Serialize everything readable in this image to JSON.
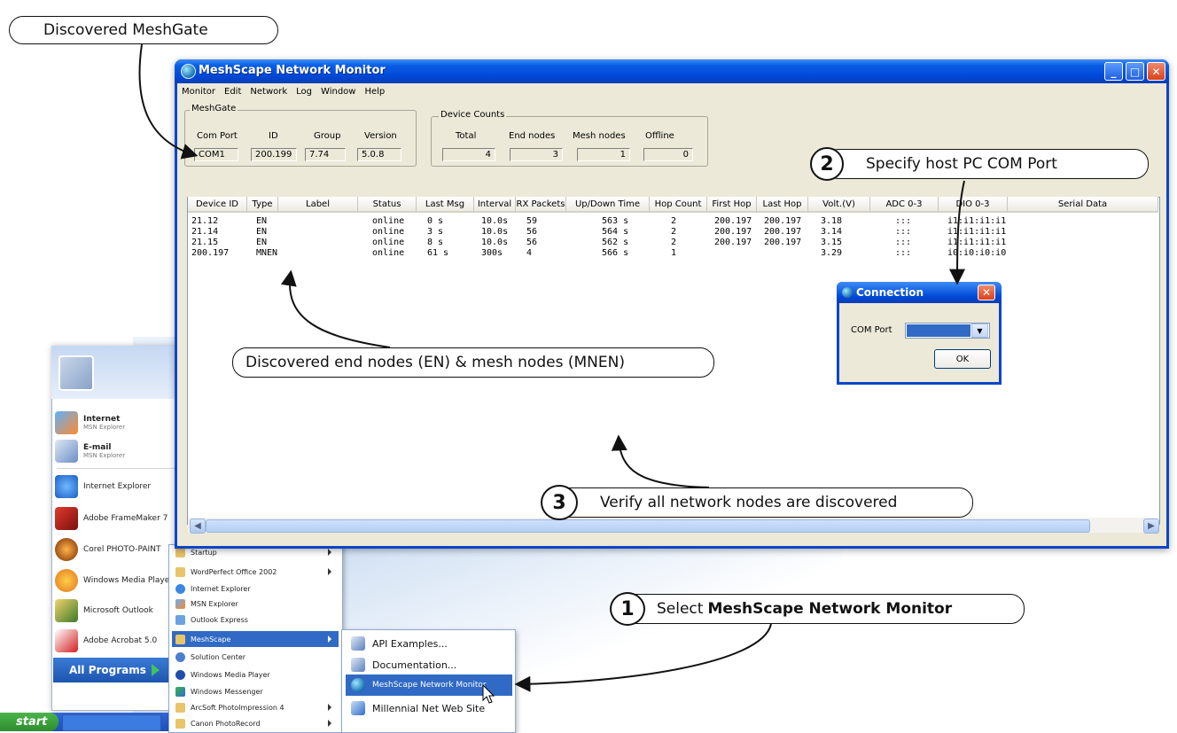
{
  "callouts": {
    "discovered_meshgate": "Discovered MeshGate",
    "discovered_nodes": "Discovered end nodes (EN) & mesh nodes (MNEN)",
    "step1_num": "1",
    "step1_text": "Select",
    "step1_bold": "MeshScape Network Monitor",
    "step2_num": "2",
    "step2_text": "Specify host PC COM Port",
    "step3_num": "3",
    "step3_text": "Verify all network nodes are discovered"
  },
  "window": {
    "title": "MeshScape Network Monitor",
    "menus": [
      "Monitor",
      "Edit",
      "Network",
      "Log",
      "Window",
      "Help"
    ]
  },
  "meshgate": {
    "group_label": "MeshGate",
    "labels": [
      "Com Port",
      "ID",
      "Group",
      "Version"
    ],
    "values": [
      "COM1",
      "200.199",
      "7.74",
      "5.0.8"
    ]
  },
  "device_counts": {
    "group_label": "Device Counts",
    "labels": [
      "Total",
      "End nodes",
      "Mesh nodes",
      "Offline"
    ],
    "values": [
      "4",
      "3",
      "1",
      "0"
    ]
  },
  "table": {
    "columns": [
      "Device ID",
      "Type",
      "Label",
      "Status",
      "Last Msg",
      "Interval",
      "RX Packets",
      "Up/Down Time",
      "Hop Count",
      "First Hop",
      "Last Hop",
      "Volt.(V)",
      "ADC 0-3",
      "DIO 0-3",
      "Serial Data"
    ],
    "rows": [
      [
        "21.12",
        "EN",
        "",
        "online",
        "0 s",
        "10.0s",
        "59",
        "563 s",
        "2",
        "200.197",
        "200.197",
        "3.18",
        ":::",
        "i1:i1:i1:i1",
        ""
      ],
      [
        "21.14",
        "EN",
        "",
        "online",
        "3 s",
        "10.0s",
        "56",
        "564 s",
        "2",
        "200.197",
        "200.197",
        "3.14",
        ":::",
        "i1:i1:i1:i1",
        ""
      ],
      [
        "21.15",
        "EN",
        "",
        "online",
        "8 s",
        "10.0s",
        "56",
        "562 s",
        "2",
        "200.197",
        "200.197",
        "3.15",
        ":::",
        "i1:i1:i1:i1",
        ""
      ],
      [
        "200.197",
        "MNEN",
        "",
        "online",
        "61 s",
        "300s",
        "4",
        "566 s",
        "1",
        "",
        "",
        "3.29",
        ":::",
        "i0:i0:i0:i0",
        ""
      ]
    ]
  },
  "dialog": {
    "title": "Connection",
    "com_label": "COM Port",
    "ok": "OK"
  },
  "start_menu": {
    "pinned": [
      {
        "title": "Internet",
        "sub": "MSN Explorer"
      },
      {
        "title": "E-mail",
        "sub": "MSN Explorer"
      }
    ],
    "recent": [
      "Internet Explorer",
      "Adobe FrameMaker 7",
      "Corel PHOTO-PAINT",
      "Windows Media Player",
      "Microsoft Outlook",
      "Adobe Acrobat 5.0"
    ],
    "all_programs": "All Programs",
    "start": "start"
  },
  "programs": [
    "Startup",
    "WordPerfect Office 2002",
    "Internet Explorer",
    "MSN Explorer",
    "Outlook Express",
    "MeshScape",
    "Solution Center",
    "Windows Media Player",
    "Windows Messenger",
    "ArcSoft PhotoImpression 4",
    "Canon PhotoRecord"
  ],
  "meshscape_submenu": [
    "API Examples...",
    "Documentation...",
    "MeshScape Network Monitor",
    "Millennial Net Web Site"
  ]
}
